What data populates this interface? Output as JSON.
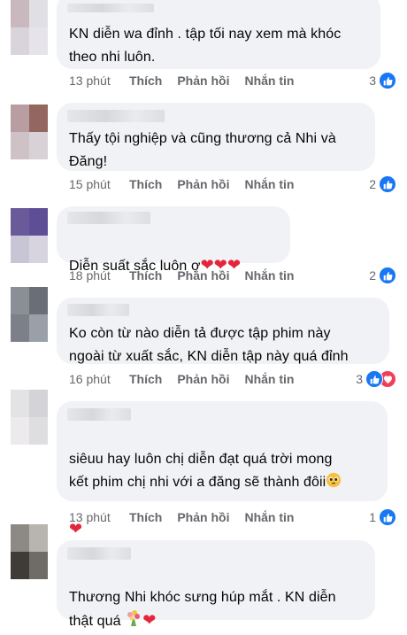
{
  "comments": [
    {
      "text": "KN diễn wa đỉnh . tập tối nay xem mà khóc\ntheo nhi luôn.",
      "time": "13 phút",
      "like_label": "Thích",
      "reply_label": "Phản hồi",
      "message_label": "Nhắn tin",
      "reaction_count": "3"
    },
    {
      "text": "Thấy tội nghiệp và cũng thương cả Nhi và\nĐăng!",
      "time": "15 phút",
      "like_label": "Thích",
      "reply_label": "Phản hồi",
      "message_label": "Nhắn tin",
      "reaction_count": "2"
    },
    {
      "text": "Diễn suất sắc luôn ợ",
      "time": "18 phút",
      "like_label": "Thích",
      "reply_label": "Phản hồi",
      "message_label": "Nhắn tin",
      "reaction_count": "2"
    },
    {
      "text": "Ko còn từ nào diễn tả được tập phim này\nngoài từ xuất sắc, KN diễn tập này quá đỉnh",
      "time": "16 phút",
      "like_label": "Thích",
      "reply_label": "Phản hồi",
      "message_label": "Nhắn tin",
      "reaction_count": "3"
    },
    {
      "text": "siêuu hay luôn chị diễn đạt quá trời mong\nkết phim chị nhi với a đăng sẽ thành đôii",
      "time": "13 phút",
      "like_label": "Thích",
      "reply_label": "Phản hồi",
      "message_label": "Nhắn tin",
      "reaction_count": "1"
    },
    {
      "text": "Thương Nhi khóc sưng húp mắt . KN diễn\nthật quá"
    }
  ],
  "icons": {
    "like": "like-icon",
    "love": "love-icon",
    "heart": "heart-emoji",
    "pleading": "pleading-face-emoji",
    "bouquet": "bouquet-emoji"
  },
  "colors": {
    "bubble": "#f0f2f5",
    "meta": "#65676b",
    "like": "#1877f2",
    "love": "#f33e58",
    "heart": "#e3263b"
  }
}
